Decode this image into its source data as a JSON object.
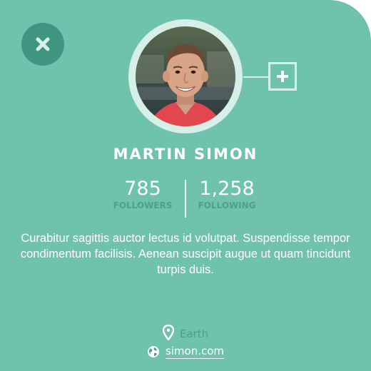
{
  "profile": {
    "name": "MARTIN SIMON",
    "avatar_alt": "Martin Simon avatar",
    "stats": {
      "followers": {
        "value": "785",
        "label": "FOLLOWERS"
      },
      "following": {
        "value": "1,258",
        "label": "FOLLOWING"
      }
    },
    "bio": "Curabitur sagittis auctor lectus id volutpat. Suspendisse tempor condimentum facilisis. Aenean suscipit augue ut quam tincidunt turpis duis.",
    "location": "Earth",
    "website": "simon.com"
  },
  "icons": {
    "close": "close-icon",
    "add": "plus-icon",
    "location": "map-pin-icon",
    "website": "globe-icon"
  },
  "colors": {
    "card_bg": "#6fc2ab",
    "accent_dark": "#3f9580",
    "muted_text": "#4e9f89",
    "ring": "#d6efe7",
    "text": "#ffffff"
  }
}
